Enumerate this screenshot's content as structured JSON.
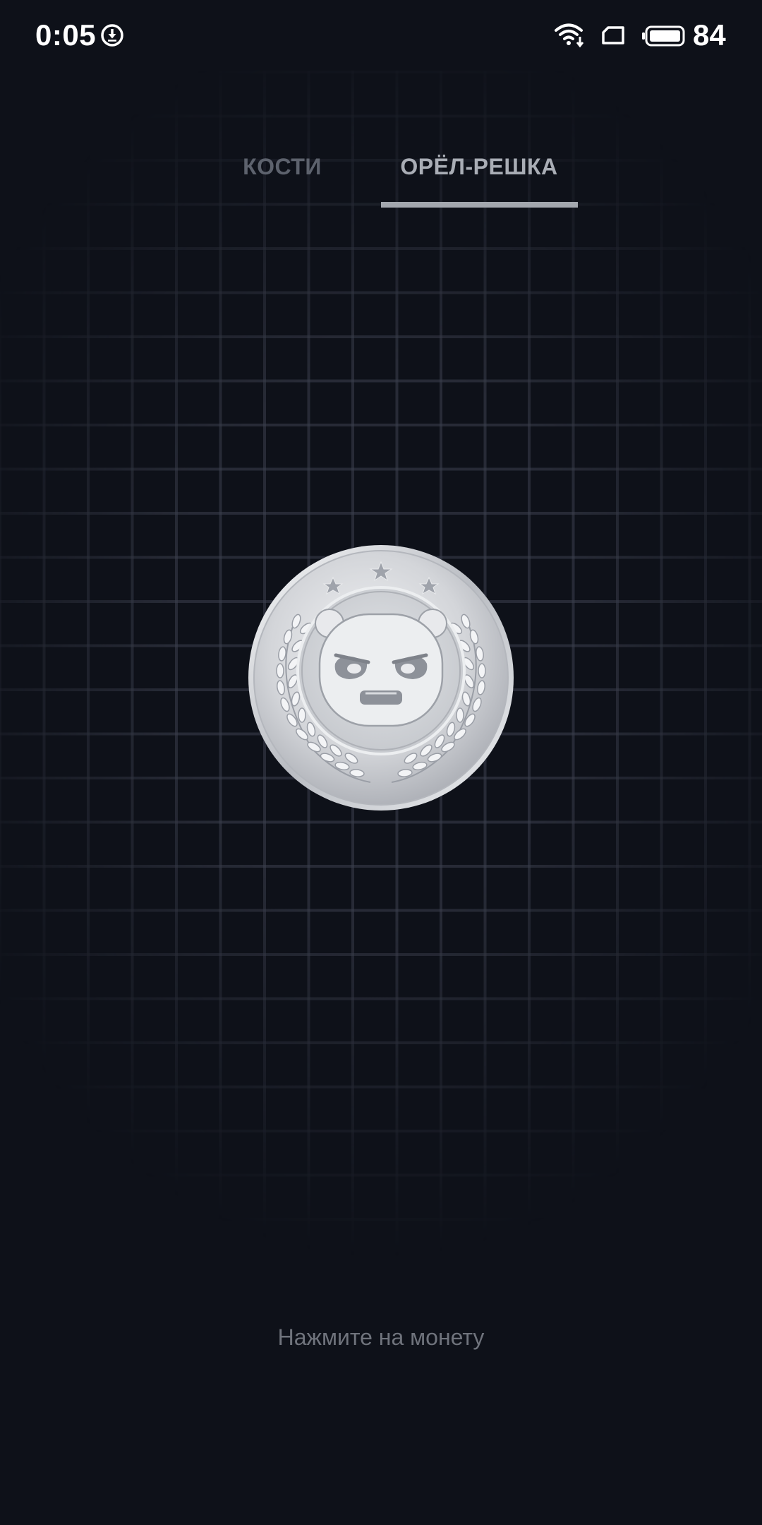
{
  "status_bar": {
    "time": "0:05",
    "battery": "84",
    "icons": [
      "download-icon",
      "wifi-icon",
      "sim-icon",
      "battery-icon"
    ]
  },
  "tabs": [
    {
      "label": "КОСТИ",
      "selected": false
    },
    {
      "label": "ОРЁЛ-РЕШКА",
      "selected": true
    }
  ],
  "coin": {
    "icon": "coin-icon",
    "face": "bear-face"
  },
  "hint": "Нажмите на монету",
  "colors": {
    "background": "#0e1119",
    "grid": "#3c404e",
    "tab_inactive": "#5d626d",
    "tab_active": "#a9adb5",
    "hint": "#6f737c",
    "coin_silver": "#d4d6da"
  }
}
